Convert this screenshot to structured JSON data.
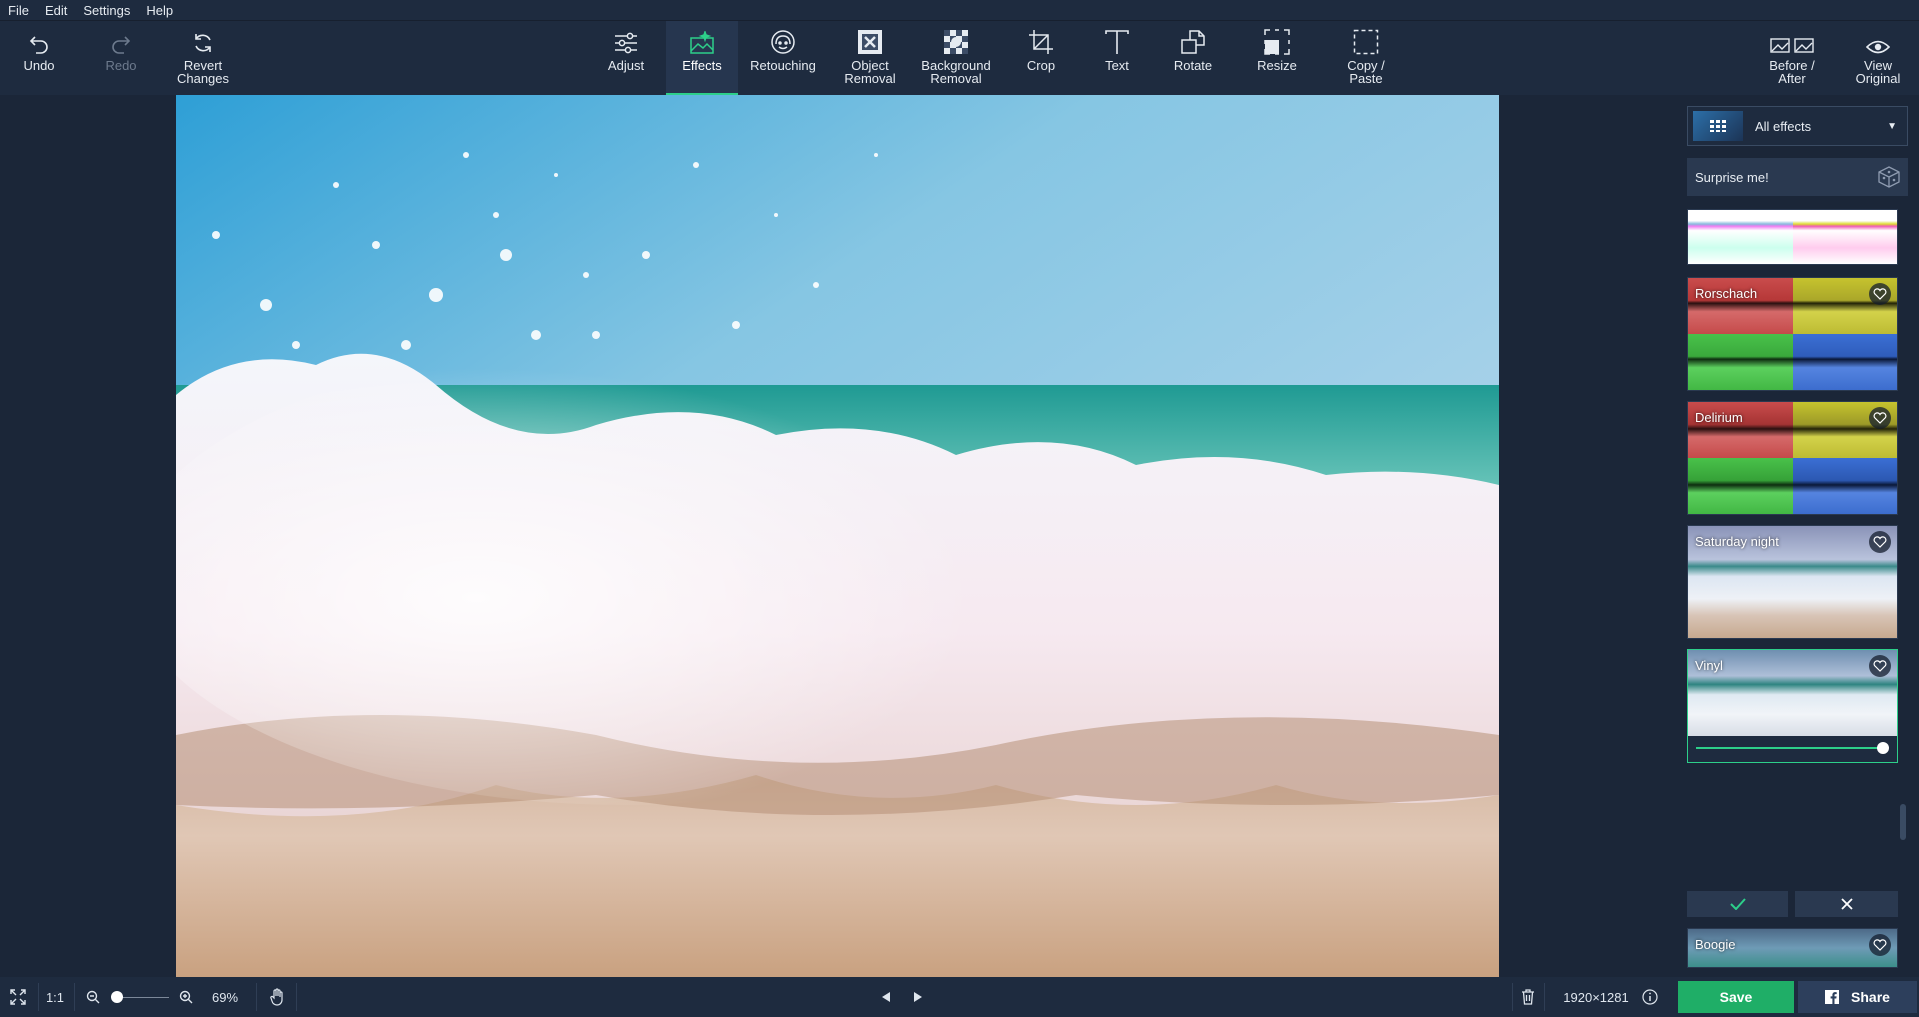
{
  "menu": [
    "File",
    "Edit",
    "Settings",
    "Help"
  ],
  "toolbar": {
    "undo": "Undo",
    "redo": "Redo",
    "revert": "Revert\nChanges",
    "adjust": "Adjust",
    "effects": "Effects",
    "retouching": "Retouching",
    "object_removal": "Object\nRemoval",
    "background_removal": "Background\nRemoval",
    "crop": "Crop",
    "text": "Text",
    "rotate": "Rotate",
    "resize": "Resize",
    "copy_paste": "Copy /\nPaste",
    "before_after": "Before /\nAfter",
    "view_original": "View\nOriginal"
  },
  "panel": {
    "category": "All effects",
    "surprise": "Surprise me!",
    "effects": [
      {
        "name": ""
      },
      {
        "name": "Rorschach"
      },
      {
        "name": "Delirium"
      },
      {
        "name": "Saturday night"
      },
      {
        "name": "Vinyl"
      },
      {
        "name": "Boogie"
      }
    ],
    "vinyl_intensity": 1.0
  },
  "bottom": {
    "ratio": "1:1",
    "zoom": "69%",
    "dimensions": "1920×1281",
    "save": "Save",
    "share": "Share"
  },
  "colors": {
    "accent": "#2dcf8a",
    "save": "#1fae67",
    "background": "#1b2638"
  }
}
